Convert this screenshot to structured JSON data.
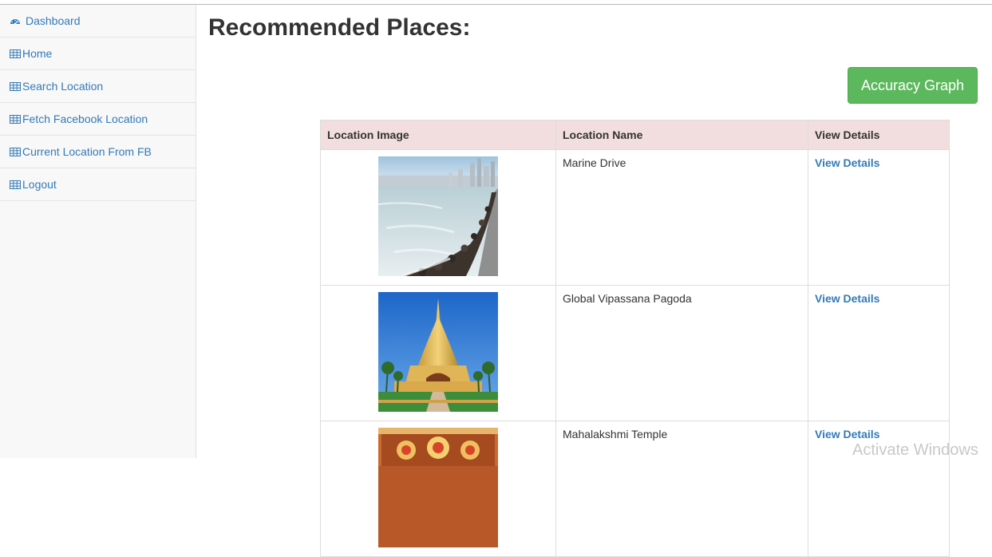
{
  "sidebar": {
    "items": [
      {
        "label": "Dashboard",
        "icon": "dashboard-icon"
      },
      {
        "label": "Home",
        "icon": "table-icon"
      },
      {
        "label": "Search Location",
        "icon": "table-icon"
      },
      {
        "label": "Fetch Facebook Location",
        "icon": "table-icon"
      },
      {
        "label": "Current Location From FB",
        "icon": "table-icon"
      },
      {
        "label": "Logout",
        "icon": "table-icon"
      }
    ]
  },
  "main": {
    "title": "Recommended Places:",
    "accuracy_button": "Accuracy Graph",
    "table": {
      "headers": [
        "Location Image",
        "Location Name",
        "View Details"
      ],
      "rows": [
        {
          "name": "Marine Drive",
          "link": "View Details"
        },
        {
          "name": "Global Vipassana Pagoda",
          "link": "View Details"
        },
        {
          "name": "Mahalakshmi Temple",
          "link": "View Details"
        }
      ]
    }
  },
  "watermark": "Activate Windows",
  "colors": {
    "link": "#337ab7",
    "success_button": "#5cb85c",
    "table_header_bg": "#f2dede",
    "sidebar_bg": "#f8f8f8"
  }
}
